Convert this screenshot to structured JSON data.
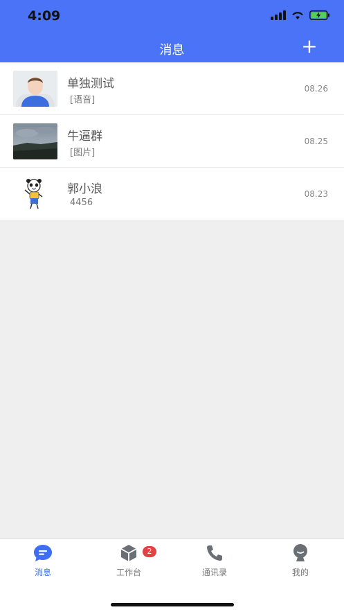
{
  "status_bar": {
    "time": "4:09"
  },
  "header": {
    "title": "消息",
    "add_label": "+"
  },
  "conversations": [
    {
      "name": "单独测试",
      "preview": "[语音]",
      "date": "08.26",
      "avatar": "person-avatar"
    },
    {
      "name": "牛逼群",
      "preview": "[图片]",
      "date": "08.25",
      "avatar": "landscape-photo"
    },
    {
      "name": "郭小浪",
      "preview": "4456",
      "date": "08.23",
      "avatar": "panda-sticker"
    }
  ],
  "tabbar": {
    "tabs": [
      {
        "label": "消息",
        "icon": "chat-bubble-icon",
        "active": true
      },
      {
        "label": "工作台",
        "icon": "box-icon",
        "badge": "2"
      },
      {
        "label": "通讯录",
        "icon": "phone-icon"
      },
      {
        "label": "我的",
        "icon": "user-icon"
      }
    ]
  },
  "colors": {
    "accent": "#4a73f7",
    "tab_active": "#3e6ef3",
    "badge": "#e04343"
  }
}
